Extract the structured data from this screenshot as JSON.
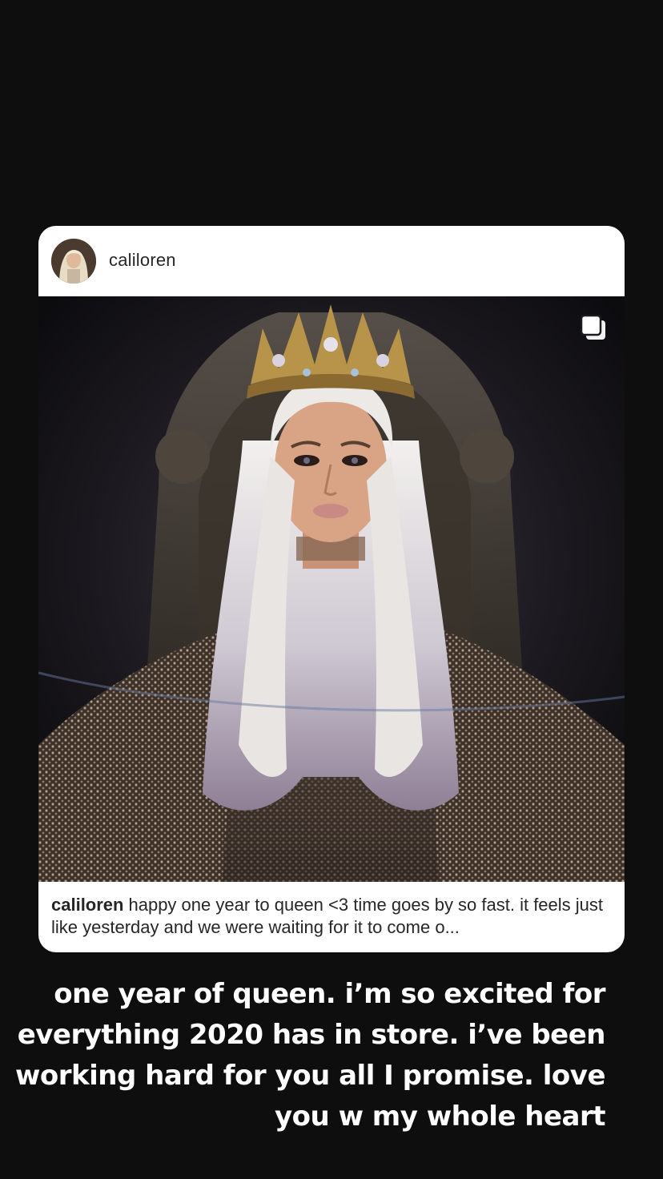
{
  "post": {
    "username": "caliloren",
    "caption_user": "caliloren",
    "caption_text": "happy one year to queen <3 time goes by so fast. it feels just like yesterday and we were waiting for it to come o...",
    "carousel_icon": "multiple-photos-icon",
    "avatar_icon": "profile-avatar"
  },
  "story": {
    "text": "one year of queen. i’m so excited for everything 2020 has in store. i’ve been working hard for you all I promise. love you w my whole heart"
  },
  "colors": {
    "background": "#0f0e0e",
    "card": "#ffffff",
    "text_dark": "#262626",
    "story_text": "#ffffff"
  }
}
